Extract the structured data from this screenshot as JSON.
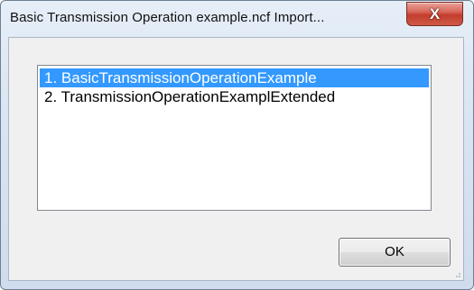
{
  "window": {
    "title": "Basic Transmission Operation example.ncf Import...",
    "close_icon": "close-x-icon"
  },
  "list": {
    "items": [
      {
        "label": "1. BasicTransmissionOperationExample",
        "selected": true
      },
      {
        "label": "2. TransmissionOperationExamplExtended",
        "selected": false
      }
    ]
  },
  "buttons": {
    "ok_label": "OK"
  },
  "colors": {
    "selection": "#3399ff",
    "close_button": "#c33d2d",
    "frame": "#d8e4f2"
  }
}
